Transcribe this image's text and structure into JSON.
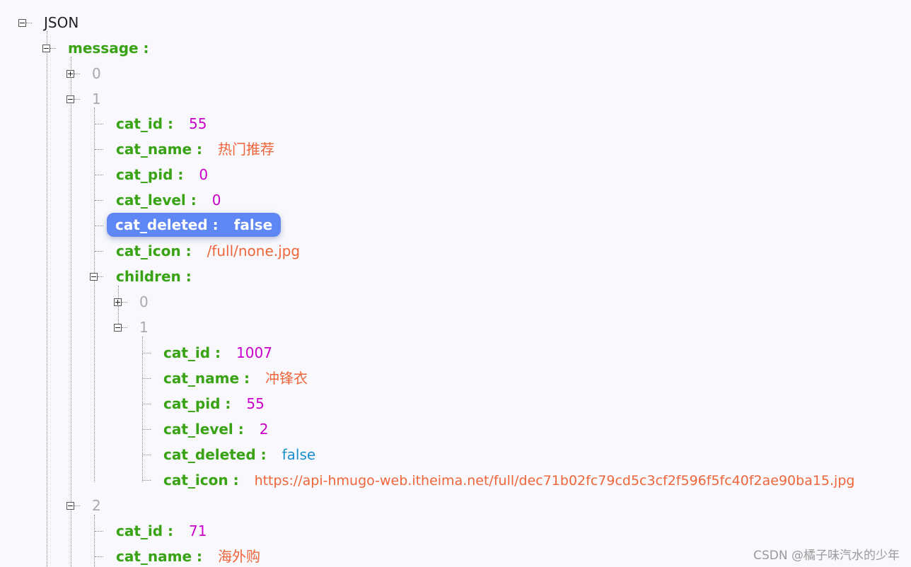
{
  "root": {
    "label": "JSON"
  },
  "message": {
    "key": "message :",
    "items": [
      {
        "index": "0",
        "collapsed": true
      },
      {
        "index": "1",
        "fields": [
          {
            "key": "cat_id :",
            "value": "55",
            "type": "number"
          },
          {
            "key": "cat_name :",
            "value": "热门推荐",
            "type": "string"
          },
          {
            "key": "cat_pid :",
            "value": "0",
            "type": "number"
          },
          {
            "key": "cat_level :",
            "value": "0",
            "type": "number"
          },
          {
            "key": "cat_deleted :",
            "value": "false",
            "type": "boolean",
            "selected": true
          },
          {
            "key": "cat_icon :",
            "value": "/full/none.jpg",
            "type": "string"
          }
        ],
        "children": {
          "key": "children :",
          "items": [
            {
              "index": "0",
              "collapsed": true
            },
            {
              "index": "1",
              "fields": [
                {
                  "key": "cat_id :",
                  "value": "1007",
                  "type": "number"
                },
                {
                  "key": "cat_name :",
                  "value": "冲锋衣",
                  "type": "string"
                },
                {
                  "key": "cat_pid :",
                  "value": "55",
                  "type": "number"
                },
                {
                  "key": "cat_level :",
                  "value": "2",
                  "type": "number"
                },
                {
                  "key": "cat_deleted :",
                  "value": "false",
                  "type": "boolean"
                },
                {
                  "key": "cat_icon :",
                  "value": "https://api-hmugo-web.itheima.net/full/dec71b02fc79cd5c3cf2f596f5fc40f2ae90ba15.jpg",
                  "type": "string"
                }
              ]
            }
          ]
        }
      },
      {
        "index": "2",
        "fields": [
          {
            "key": "cat_id :",
            "value": "71",
            "type": "number"
          },
          {
            "key": "cat_name :",
            "value": "海外购",
            "type": "string"
          }
        ]
      }
    ]
  },
  "watermark": "CSDN @橘子味汽水的少年",
  "colors": {
    "key": "#3aa315",
    "number": "#cc00cc",
    "string": "#f0653a",
    "boolean": "#1a8fcf",
    "index": "#a9a9a9",
    "selection": "#5f86f5"
  }
}
